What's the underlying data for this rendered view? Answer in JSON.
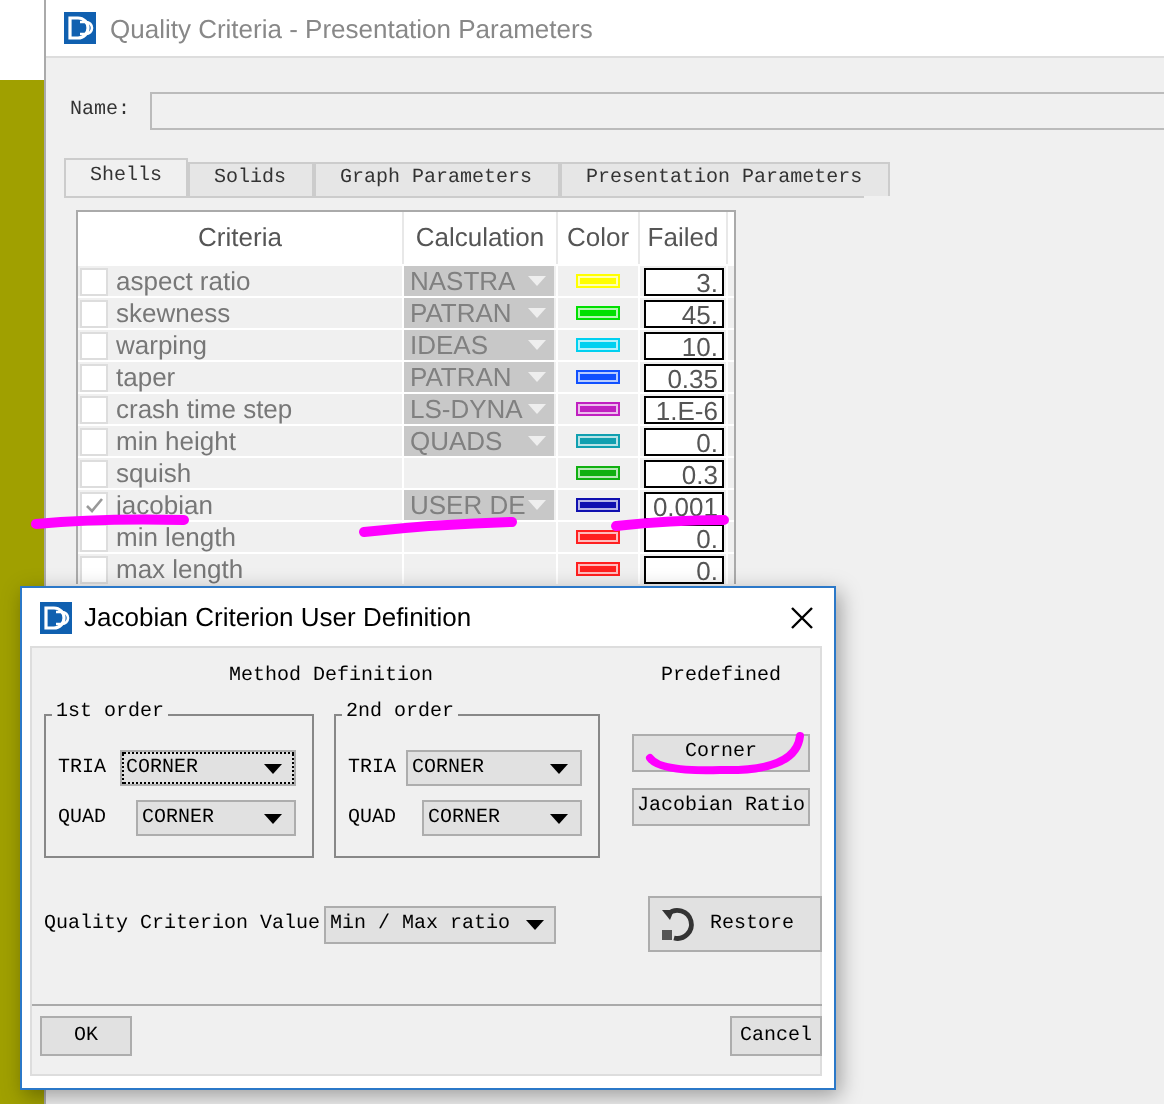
{
  "main_window": {
    "title": "Quality Criteria - Presentation Parameters",
    "name_label": "Name:"
  },
  "tabs": [
    {
      "label": "Shells",
      "selected": true
    },
    {
      "label": "Solids",
      "selected": false
    },
    {
      "label": "Graph Parameters",
      "selected": false
    },
    {
      "label": "Presentation Parameters",
      "selected": false
    }
  ],
  "table": {
    "columns": [
      "Criteria",
      "Calculation",
      "Color",
      "Failed"
    ],
    "rows": [
      {
        "checked": false,
        "criteria": "aspect ratio",
        "calculation": "NASTRA",
        "color": "#ffff00",
        "failed": "3."
      },
      {
        "checked": false,
        "criteria": "skewness",
        "calculation": "PATRAN",
        "color": "#00e000",
        "failed": "45."
      },
      {
        "checked": false,
        "criteria": "warping",
        "calculation": "IDEAS",
        "color": "#00d0f0",
        "failed": "10."
      },
      {
        "checked": false,
        "criteria": "taper",
        "calculation": "PATRAN",
        "color": "#1050ff",
        "failed": "0.35"
      },
      {
        "checked": false,
        "criteria": "crash time step",
        "calculation": "LS-DYNA",
        "color": "#c020c0",
        "failed": "1.E-6"
      },
      {
        "checked": false,
        "criteria": "min height",
        "calculation": "QUADS",
        "color": "#10a0b0",
        "failed": "0."
      },
      {
        "checked": false,
        "criteria": "squish",
        "color": "#10b010",
        "failed": "0.3"
      },
      {
        "checked": true,
        "criteria": "jacobian",
        "calculation": "USER DE",
        "color": "#1010b0",
        "failed": "0.001"
      },
      {
        "checked": false,
        "criteria": "min length",
        "color": "#ff2020",
        "failed": "0."
      },
      {
        "checked": false,
        "criteria": "max length",
        "color": "#ff2020",
        "failed": "0."
      }
    ]
  },
  "dialog": {
    "title": "Jacobian Criterion User Definition",
    "method_heading": "Method Definition",
    "groups": [
      {
        "title": "1st order",
        "fields": [
          {
            "label": "TRIA",
            "value": "CORNER",
            "focused": true
          },
          {
            "label": "QUAD",
            "value": "CORNER",
            "focused": false
          }
        ]
      },
      {
        "title": "2nd order",
        "fields": [
          {
            "label": "TRIA",
            "value": "CORNER",
            "focused": false
          },
          {
            "label": "QUAD",
            "value": "CORNER",
            "focused": false
          }
        ]
      }
    ],
    "predefined_heading": "Predefined",
    "predefined_buttons": [
      "Corner",
      "Jacobian Ratio"
    ],
    "quality_label": "Quality Criterion Value",
    "quality_value": "Min / Max ratio",
    "restore": "Restore",
    "buttons": [
      "OK",
      "Cancel"
    ]
  }
}
